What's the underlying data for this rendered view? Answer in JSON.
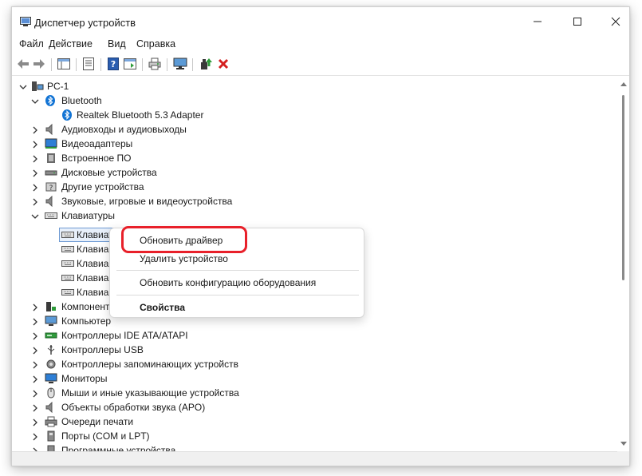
{
  "window": {
    "title": "Диспетчер устройств"
  },
  "menu": [
    "Файл",
    "Действие",
    "Вид",
    "Справка"
  ],
  "toolbar_icons": [
    "back-icon",
    "forward-icon",
    "show-hide-tree-icon",
    "properties-icon",
    "help-icon",
    "action-pane-icon",
    "print-icon",
    "monitor-icon",
    "update-driver-icon",
    "uninstall-icon"
  ],
  "tree": {
    "root": "PC-1",
    "bluetooth": {
      "label": "Bluetooth",
      "child": "Realtek Bluetooth 5.3 Adapter"
    },
    "categories_a": [
      "Аудиовходы и аудиовыходы",
      "Видеоадаптеры",
      "Встроенное ПО",
      "Дисковые устройства",
      "Другие устройства",
      "Звуковые, игровые и видеоустройства"
    ],
    "keyboards": {
      "label": "Клавиатуры",
      "children": [
        "Клавиатура HID",
        "Клавиа",
        "Клавиа",
        "Клавиа",
        "Клавиа"
      ]
    },
    "categories_b": [
      "Компоненты",
      "Компьютер",
      "Контроллеры IDE ATA/ATAPI",
      "Контроллеры USB",
      "Контроллеры запоминающих устройств",
      "Мониторы",
      "Мыши и иные указывающие устройства",
      "Объекты обработки звука (APO)",
      "Очереди печати",
      "Порты (COM и LPT)",
      "Программные устройства"
    ]
  },
  "context_menu": {
    "update_driver": "Обновить драйвер",
    "uninstall": "Удалить устройство",
    "scan": "Обновить конфигурацию оборудования",
    "properties": "Свойства"
  },
  "colors": {
    "highlight": "#e8202a",
    "bluetooth": "#1173d4",
    "uninstall": "#d42020",
    "accent": "#6e9ad3"
  }
}
